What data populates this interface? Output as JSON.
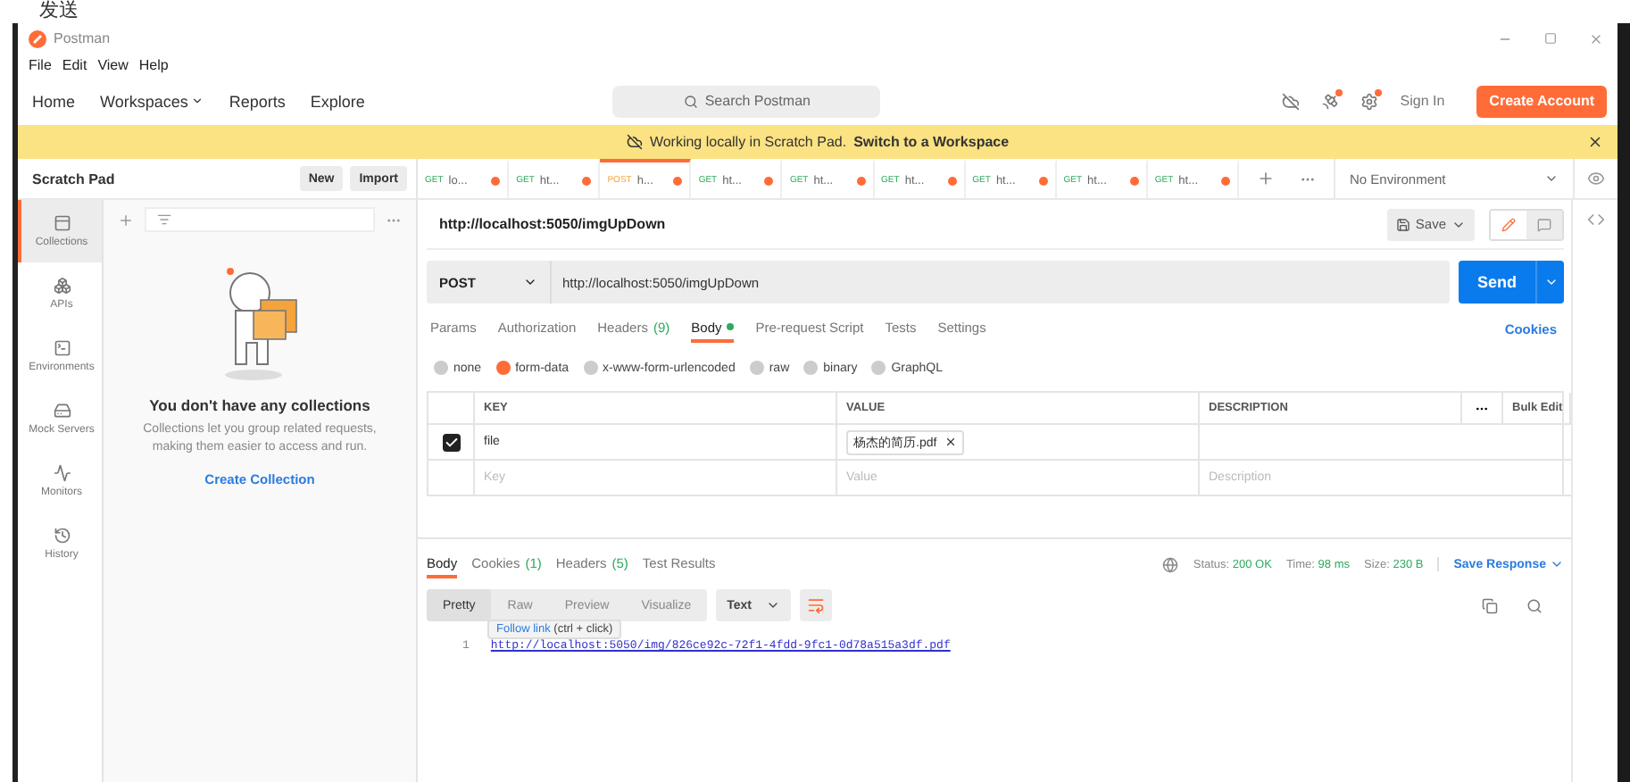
{
  "page_top": {
    "text": "发送"
  },
  "window": {
    "title": "Postman"
  },
  "menu": [
    "File",
    "Edit",
    "View",
    "Help"
  ],
  "nav": [
    {
      "label": "Home",
      "kind": "link"
    },
    {
      "label": "Workspaces",
      "kind": "dropdown"
    },
    {
      "label": "Reports",
      "kind": "link"
    },
    {
      "label": "Explore",
      "kind": "link"
    }
  ],
  "search": {
    "placeholder": "Search Postman"
  },
  "header_actions": [
    {
      "kind": "sync",
      "notify": false
    },
    {
      "kind": "satellite",
      "notify": true
    },
    {
      "kind": "settings",
      "notify": true
    }
  ],
  "sign_in": "Sign In",
  "create_account": "Create Account",
  "banner": {
    "text": "Working locally in Scratch Pad.",
    "link": "Switch to a Workspace"
  },
  "sidebar": {
    "title": "Scratch Pad",
    "buttons": [
      "New",
      "Import"
    ],
    "nav": [
      {
        "label": "Collections",
        "kind": "collections",
        "selected": true
      },
      {
        "label": "APIs",
        "kind": "apis",
        "selected": false
      },
      {
        "label": "Environments",
        "kind": "environments",
        "selected": false
      },
      {
        "label": "Mock Servers",
        "kind": "mock",
        "selected": false
      },
      {
        "label": "Monitors",
        "kind": "monitors",
        "selected": false
      },
      {
        "label": "History",
        "kind": "history",
        "selected": false
      }
    ],
    "empty": {
      "title": "You don't have any collections",
      "text": "Collections let you group related requests, making them easier to access and run.",
      "action": "Create Collection"
    }
  },
  "request_tabs": [
    {
      "method": "GET",
      "label": "lo...",
      "selected": false,
      "unsaved": true
    },
    {
      "method": "GET",
      "label": "ht...",
      "selected": false,
      "unsaved": true
    },
    {
      "method": "POST",
      "label": "h...",
      "selected": true,
      "unsaved": true
    },
    {
      "method": "GET",
      "label": "ht...",
      "selected": false,
      "unsaved": true
    },
    {
      "method": "GET",
      "label": "ht...",
      "selected": false,
      "unsaved": true
    },
    {
      "method": "GET",
      "label": "ht...",
      "selected": false,
      "unsaved": true
    },
    {
      "method": "GET",
      "label": "ht...",
      "selected": false,
      "unsaved": true
    },
    {
      "method": "GET",
      "label": "ht...",
      "selected": false,
      "unsaved": true
    },
    {
      "method": "GET",
      "label": "ht...",
      "selected": false,
      "unsaved": true
    }
  ],
  "environment": "No Environment",
  "request": {
    "name": "http://localhost:5050/imgUpDown",
    "save": "Save",
    "method": "POST",
    "url": "http://localhost:5050/imgUpDown",
    "send": "Send",
    "tabs": [
      {
        "label": "Params",
        "selected": false
      },
      {
        "label": "Authorization",
        "selected": false
      },
      {
        "label": "Headers",
        "count": "(9)",
        "selected": false
      },
      {
        "label": "Body",
        "dot": true,
        "selected": true
      },
      {
        "label": "Pre-request Script",
        "selected": false
      },
      {
        "label": "Tests",
        "selected": false
      },
      {
        "label": "Settings",
        "selected": false
      }
    ],
    "cookies": "Cookies",
    "body_types": [
      {
        "label": "none",
        "selected": false
      },
      {
        "label": "form-data",
        "selected": true
      },
      {
        "label": "x-www-form-urlencoded",
        "selected": false
      },
      {
        "label": "raw",
        "selected": false
      },
      {
        "label": "binary",
        "selected": false
      },
      {
        "label": "GraphQL",
        "selected": false
      }
    ],
    "table": {
      "columns": [
        "KEY",
        "VALUE",
        "DESCRIPTION"
      ],
      "bulk_edit": "Bulk Edit",
      "rows": [
        {
          "checked": true,
          "key": "file",
          "value": "杨杰的简历.pdf"
        }
      ],
      "new_row": {
        "key": "Key",
        "value": "Value",
        "description": "Description"
      }
    }
  },
  "response": {
    "tabs": [
      {
        "label": "Body",
        "selected": true
      },
      {
        "label": "Cookies",
        "count": "(1)",
        "selected": false
      },
      {
        "label": "Headers",
        "count": "(5)",
        "selected": false
      },
      {
        "label": "Test Results",
        "selected": false
      }
    ],
    "status_label": "Status:",
    "status": "200 OK",
    "time_label": "Time:",
    "time": "98 ms",
    "size_label": "Size:",
    "size": "230 B",
    "save": "Save Response",
    "views": [
      {
        "label": "Pretty",
        "selected": true
      },
      {
        "label": "Raw",
        "selected": false
      },
      {
        "label": "Preview",
        "selected": false
      },
      {
        "label": "Visualize",
        "selected": false
      }
    ],
    "format": "Text",
    "tooltip": {
      "link": "Follow link",
      "hint": "(ctrl + click)"
    },
    "lines": [
      {
        "number": "1",
        "text": "http://localhost:5050/img/826ce92c-72f1-4fdd-9fc1-0d78a515a3df.pdf"
      }
    ]
  }
}
